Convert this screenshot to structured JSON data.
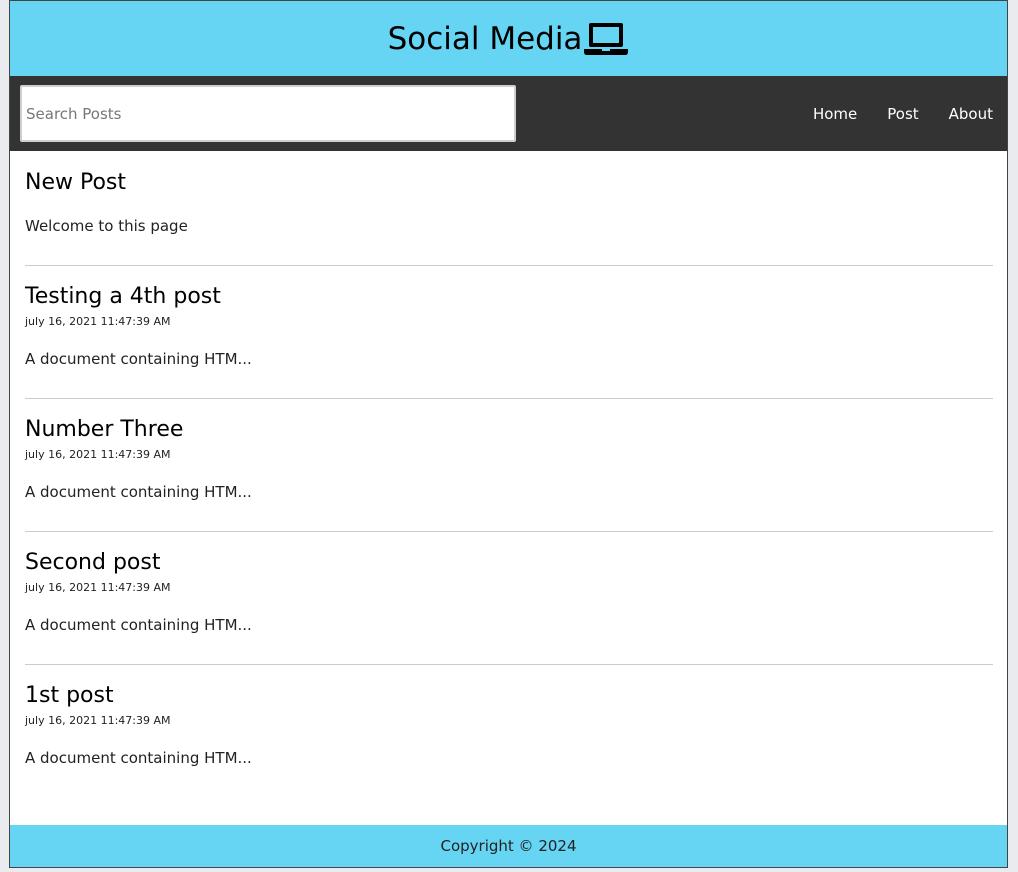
{
  "header": {
    "title": "Social Media",
    "icon": "laptop-icon"
  },
  "nav": {
    "search_placeholder": "Search Posts",
    "search_value": "",
    "links": [
      {
        "label": "Home"
      },
      {
        "label": "Post"
      },
      {
        "label": "About"
      }
    ]
  },
  "posts": [
    {
      "title": "New Post",
      "date": "",
      "body": "Welcome to this page"
    },
    {
      "title": "Testing a 4th post",
      "date": "july 16, 2021 11:47:39 AM",
      "body": "A document containing HTM..."
    },
    {
      "title": "Number Three",
      "date": "july 16, 2021 11:47:39 AM",
      "body": "A document containing HTM..."
    },
    {
      "title": "Second post",
      "date": "july 16, 2021 11:47:39 AM",
      "body": "A document containing HTM..."
    },
    {
      "title": "1st post",
      "date": "july 16, 2021 11:47:39 AM",
      "body": "A document containing HTM..."
    }
  ],
  "footer": {
    "copyright": "Copyright © 2024"
  },
  "colors": {
    "accent": "#66d5f4",
    "nav_bg": "#333333"
  }
}
